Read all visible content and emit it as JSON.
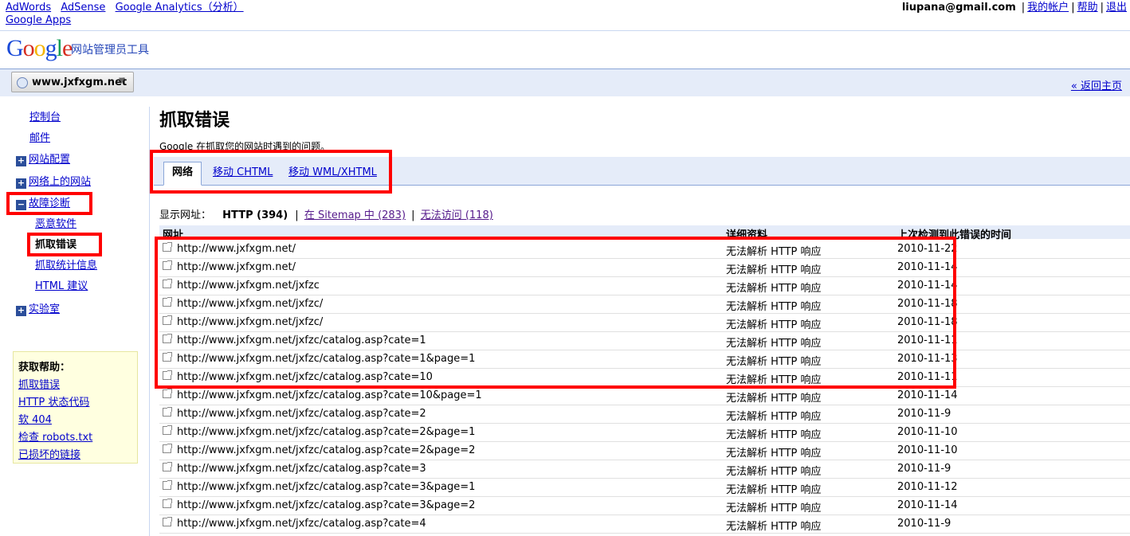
{
  "topbar": {
    "links": [
      "AdWords",
      "AdSense",
      "Google Analytics（分析）",
      "Google Apps"
    ],
    "user_email": "liupana@gmail.com",
    "my_account": "我的帐户",
    "help": "帮助",
    "sign_out": "退出"
  },
  "logo": {
    "text": "Google",
    "product": "网站管理员工具"
  },
  "sitebar": {
    "site": "www.jxfxgm.net",
    "back_home": "« 返回主页"
  },
  "sidebar": {
    "items": [
      {
        "label": "控制台"
      },
      {
        "label": "邮件"
      },
      {
        "label": "网站配置",
        "icon": "plus-icon"
      },
      {
        "label": "网络上的网站",
        "icon": "plus-icon"
      },
      {
        "label": "故障诊断",
        "icon": "minus-icon"
      },
      {
        "label": "恶意软件"
      },
      {
        "label": "抓取错误"
      },
      {
        "label": "抓取统计信息"
      },
      {
        "label": "HTML 建议"
      },
      {
        "label": "实验室",
        "icon": "plus-icon"
      }
    ],
    "help": {
      "title": "获取帮助：",
      "links": [
        "抓取错误",
        "HTTP 状态代码",
        "软 404",
        "检查 robots.txt",
        "已损坏的链接"
      ]
    }
  },
  "main": {
    "title": "抓取错误",
    "description": "Google 在抓取您的网站时遇到的问题。",
    "tabs": [
      "网络",
      "移动 CHTML",
      "移动 WML/XHTML"
    ],
    "filter": {
      "label": "显示网址：",
      "http": "HTTP (394)",
      "sitemap": "在 Sitemap 中 (283)",
      "unreachable": "无法访问 (118)"
    },
    "columns": [
      "网址",
      "详细资料",
      "上次检测到此错误的时间"
    ],
    "rows": [
      {
        "url": "http://www.jxfxgm.net/",
        "detail": "无法解析 HTTP 响应",
        "date": "2010-11-22"
      },
      {
        "url": "http://www.jxfxgm.net/",
        "detail": "无法解析 HTTP 响应",
        "date": "2010-11-14"
      },
      {
        "url": "http://www.jxfxgm.net/jxfzc",
        "detail": "无法解析 HTTP 响应",
        "date": "2010-11-14"
      },
      {
        "url": "http://www.jxfxgm.net/jxfzc/",
        "detail": "无法解析 HTTP 响应",
        "date": "2010-11-18"
      },
      {
        "url": "http://www.jxfxgm.net/jxfzc/",
        "detail": "无法解析 HTTP 响应",
        "date": "2010-11-18"
      },
      {
        "url": "http://www.jxfxgm.net/jxfzc/catalog.asp?cate=1",
        "detail": "无法解析 HTTP 响应",
        "date": "2010-11-11"
      },
      {
        "url": "http://www.jxfxgm.net/jxfzc/catalog.asp?cate=1&page=1",
        "detail": "无法解析 HTTP 响应",
        "date": "2010-11-13"
      },
      {
        "url": "http://www.jxfxgm.net/jxfzc/catalog.asp?cate=10",
        "detail": "无法解析 HTTP 响应",
        "date": "2010-11-11"
      },
      {
        "url": "http://www.jxfxgm.net/jxfzc/catalog.asp?cate=10&page=1",
        "detail": "无法解析 HTTP 响应",
        "date": "2010-11-14"
      },
      {
        "url": "http://www.jxfxgm.net/jxfzc/catalog.asp?cate=2",
        "detail": "无法解析 HTTP 响应",
        "date": "2010-11-9"
      },
      {
        "url": "http://www.jxfxgm.net/jxfzc/catalog.asp?cate=2&page=1",
        "detail": "无法解析 HTTP 响应",
        "date": "2010-11-10"
      },
      {
        "url": "http://www.jxfxgm.net/jxfzc/catalog.asp?cate=2&page=2",
        "detail": "无法解析 HTTP 响应",
        "date": "2010-11-10"
      },
      {
        "url": "http://www.jxfxgm.net/jxfzc/catalog.asp?cate=3",
        "detail": "无法解析 HTTP 响应",
        "date": "2010-11-9"
      },
      {
        "url": "http://www.jxfxgm.net/jxfzc/catalog.asp?cate=3&page=1",
        "detail": "无法解析 HTTP 响应",
        "date": "2010-11-12"
      },
      {
        "url": "http://www.jxfxgm.net/jxfzc/catalog.asp?cate=3&page=2",
        "detail": "无法解析 HTTP 响应",
        "date": "2010-11-14"
      },
      {
        "url": "http://www.jxfxgm.net/jxfzc/catalog.asp?cate=4",
        "detail": "无法解析 HTTP 响应",
        "date": "2010-11-9"
      }
    ]
  },
  "colors": {
    "highlight": "#ff0000",
    "link": "#0000cc",
    "header_bg": "#e5ecf9"
  }
}
